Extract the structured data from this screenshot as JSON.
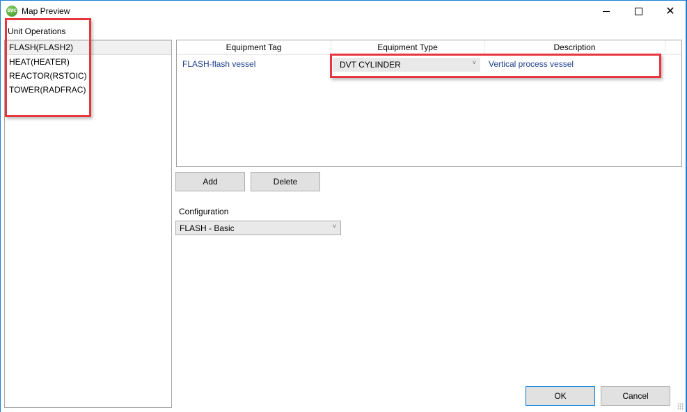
{
  "window": {
    "title": "Map Preview",
    "app_icon": "svc-app-icon",
    "app_icon_text": "SVC",
    "controls": {
      "minimize": "minimize-icon",
      "maximize": "maximize-icon",
      "close": "close-icon",
      "close_glyph": "✕"
    }
  },
  "unit_operations": {
    "label": "Unit Operations",
    "items": [
      {
        "label": "FLASH(FLASH2)",
        "selected": true
      },
      {
        "label": "HEAT(HEATER)",
        "selected": false
      },
      {
        "label": "REACTOR(RSTOIC)",
        "selected": false
      },
      {
        "label": "TOWER(RADFRAC)",
        "selected": false
      }
    ]
  },
  "grid": {
    "columns": [
      "Equipment Tag",
      "Equipment Type",
      "Description"
    ],
    "rows": [
      {
        "equipment_tag": "FLASH-flash vessel",
        "equipment_type": "DVT CYLINDER",
        "description": "Vertical process vessel"
      }
    ],
    "dropdown_glyph": "˅"
  },
  "actions": {
    "add": "Add",
    "delete": "Delete"
  },
  "configuration": {
    "label": "Configuration",
    "value": "FLASH - Basic",
    "dropdown_glyph": "˅"
  },
  "dialog_buttons": {
    "ok": "OK",
    "cancel": "Cancel"
  },
  "colors": {
    "highlight": "#e8363e",
    "link_text": "#1f3f8f",
    "window_border": "#1a7fd4"
  }
}
